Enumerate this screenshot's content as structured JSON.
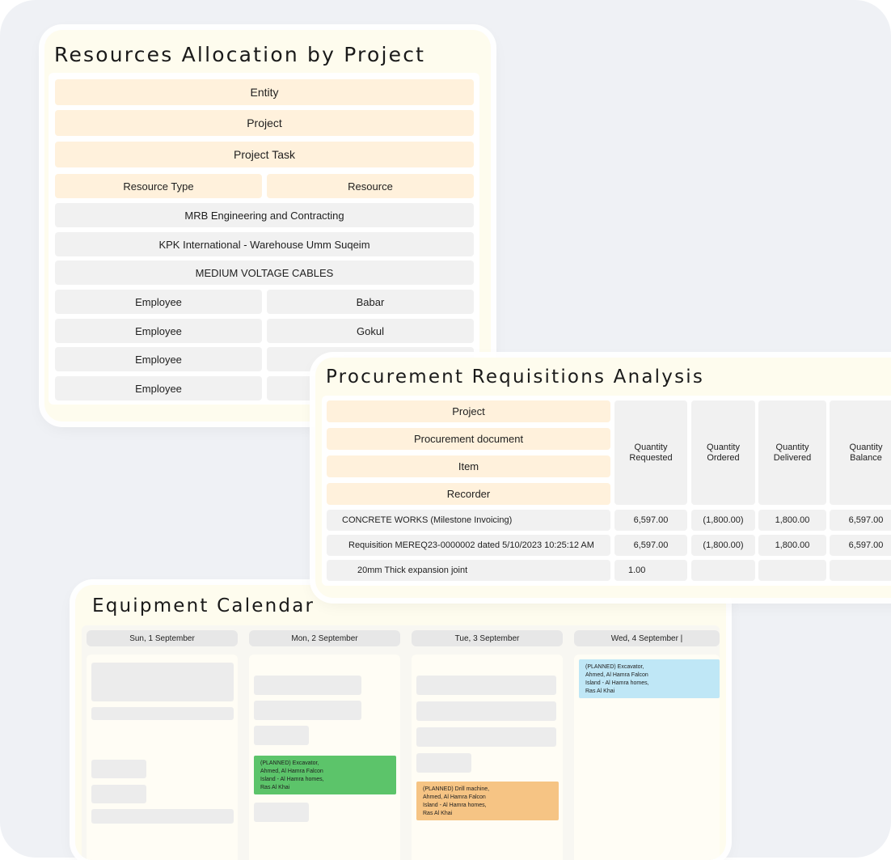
{
  "resources": {
    "title": "Resources Allocation by Project",
    "headers": {
      "entity": "Entity",
      "project": "Project",
      "project_task": "Project Task",
      "resource_type": "Resource Type",
      "resource": "Resource"
    },
    "entity_value": "MRB Engineering and Contracting",
    "project_value": "KPK International - Warehouse Umm Suqeim",
    "task_value": "MEDIUM VOLTAGE CABLES",
    "rows": [
      {
        "type": "Employee",
        "resource": "Babar"
      },
      {
        "type": "Employee",
        "resource": "Gokul"
      },
      {
        "type": "Employee",
        "resource": ""
      },
      {
        "type": "Employee",
        "resource": ""
      }
    ]
  },
  "procurement": {
    "title": "Procurement Requisitions Analysis",
    "group_headers": [
      "Project",
      "Procurement document",
      "Item",
      "Recorder"
    ],
    "columns": [
      {
        "l1": "Quantity",
        "l2": "Requested"
      },
      {
        "l1": "Quantity",
        "l2": "Ordered"
      },
      {
        "l1": "Quantity",
        "l2": "Delivered"
      },
      {
        "l1": "Quantity",
        "l2": "Balance"
      }
    ],
    "rows": [
      {
        "label": "CONCRETE WORKS (Milestone Invoicing)",
        "values": [
          "6,597.00",
          "(1,800.00)",
          "1,800.00",
          "6,597.00"
        ]
      },
      {
        "label": "Requisition MEREQ23-0000002 dated 5/10/2023 10:25:12 AM",
        "values": [
          "6,597.00",
          "(1,800.00)",
          "1,800.00",
          "6,597.00"
        ]
      },
      {
        "label": "20mm Thick expansion joint",
        "values": [
          "1.00",
          "",
          "",
          ""
        ]
      }
    ]
  },
  "calendar": {
    "title": "Equipment Calendar",
    "days": [
      "Sun, 1 September",
      "Mon, 2 September",
      "Tue, 3 September",
      "Wed, 4 September |"
    ],
    "events": {
      "mon": {
        "l1": "(PLANNED) Excavator,",
        "l2": "Ahmed, Al Hamra Falcon",
        "l3": "Island - Al Hamra homes,",
        "l4": "Ras Al Khai",
        "color": "#5cc46a"
      },
      "tue": {
        "l1": "(PLANNED) Drill machine,",
        "l2": "Ahmed, Al Hamra Falcon",
        "l3": "Island - Al Hamra homes,",
        "l4": "Ras Al Khai",
        "color": "#f6c484"
      },
      "wed": {
        "l1": "(PLANNED) Excavator,",
        "l2": "Ahmed, Al Hamra Falcon",
        "l3": "Island - Al Hamra homes,",
        "l4": "Ras Al Khai",
        "color": "#bfe7f6"
      }
    }
  }
}
